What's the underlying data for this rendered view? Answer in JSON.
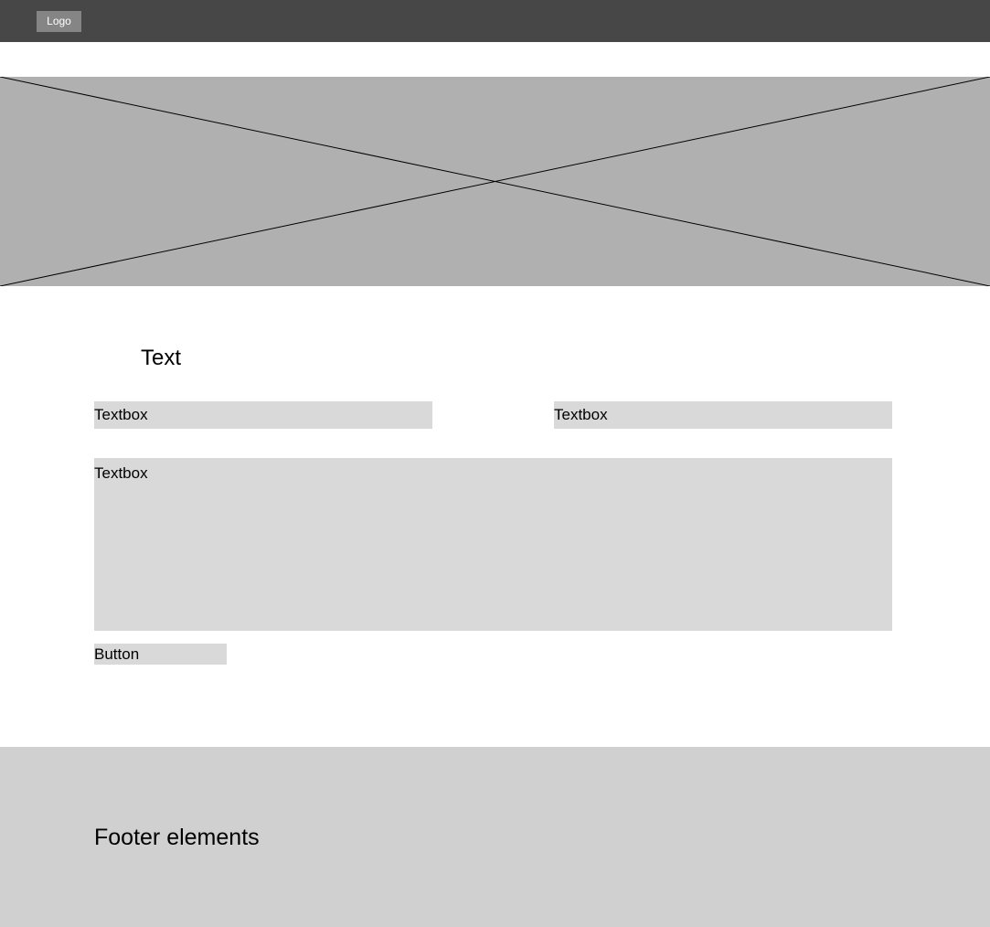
{
  "header": {
    "logo_label": "Logo"
  },
  "hero": {
    "image": "image-placeholder"
  },
  "main": {
    "title": "Text",
    "textbox_1": "Textbox",
    "textbox_2": "Textbox",
    "textbox_3": "Textbox",
    "button_label": "Button"
  },
  "footer": {
    "text": "Footer elements"
  },
  "colors": {
    "header_bg": "#474747",
    "logo_bg": "#858585",
    "hero_bg": "#b0b0b0",
    "field_bg": "#d9d9d9",
    "footer_bg": "#d0d0d0"
  }
}
